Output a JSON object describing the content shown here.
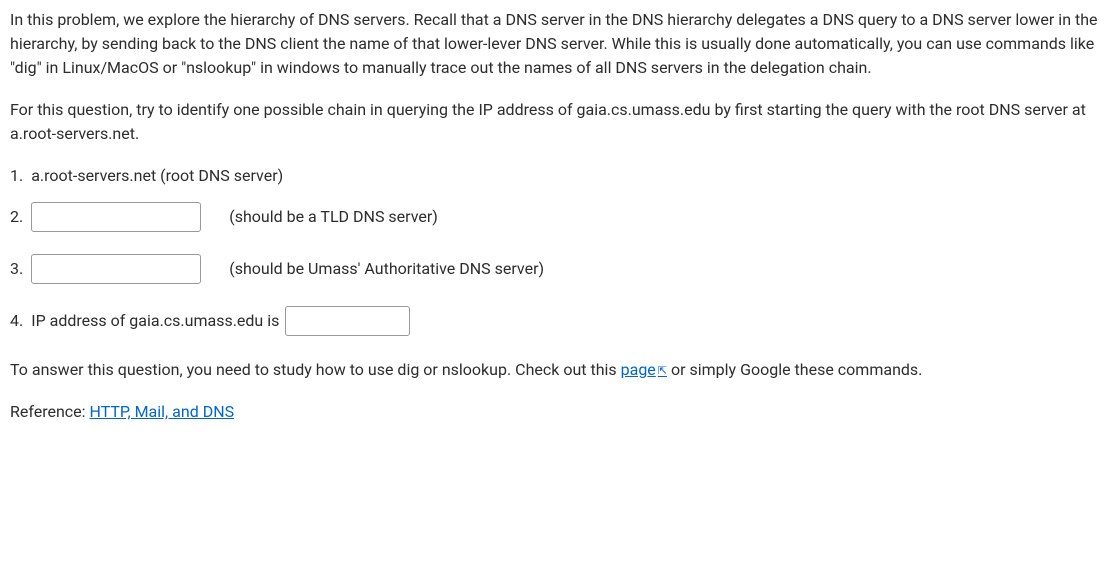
{
  "intro_para": "In this problem, we explore the hierarchy of DNS servers. Recall that a DNS server in the DNS hierarchy delegates a DNS query to a DNS server lower in the hierarchy, by sending back to the DNS client the name of that lower-lever DNS server. While this is usually done automatically, you can use commands like \"dig\" in Linux/MacOS or \"nslookup\" in windows to manually trace out the names of all DNS servers in the delegation chain.",
  "instruction_para": "For this question, try to identify one possible chain in querying the IP address of gaia.cs.umass.edu by first starting the query with the root DNS server at a.root-servers.net.",
  "item1": {
    "num": "1.",
    "text": "a.root-servers.net  (root DNS server)"
  },
  "item2": {
    "num": "2.",
    "hint": "(should be a TLD DNS server)",
    "value": ""
  },
  "item3": {
    "num": "3.",
    "hint": "(should be Umass' Authoritative DNS server)",
    "value": ""
  },
  "item4": {
    "num_prefix": "4.",
    "label": "IP address of gaia.cs.umass.edu is",
    "value": ""
  },
  "footer": {
    "before_link": "To answer this question, you need to study how to use dig or nslookup. Check out this ",
    "link_text": "page",
    "after_link": " or simply Google these commands."
  },
  "reference": {
    "prefix": "Reference: ",
    "link_text": "HTTP, Mail, and DNS"
  }
}
